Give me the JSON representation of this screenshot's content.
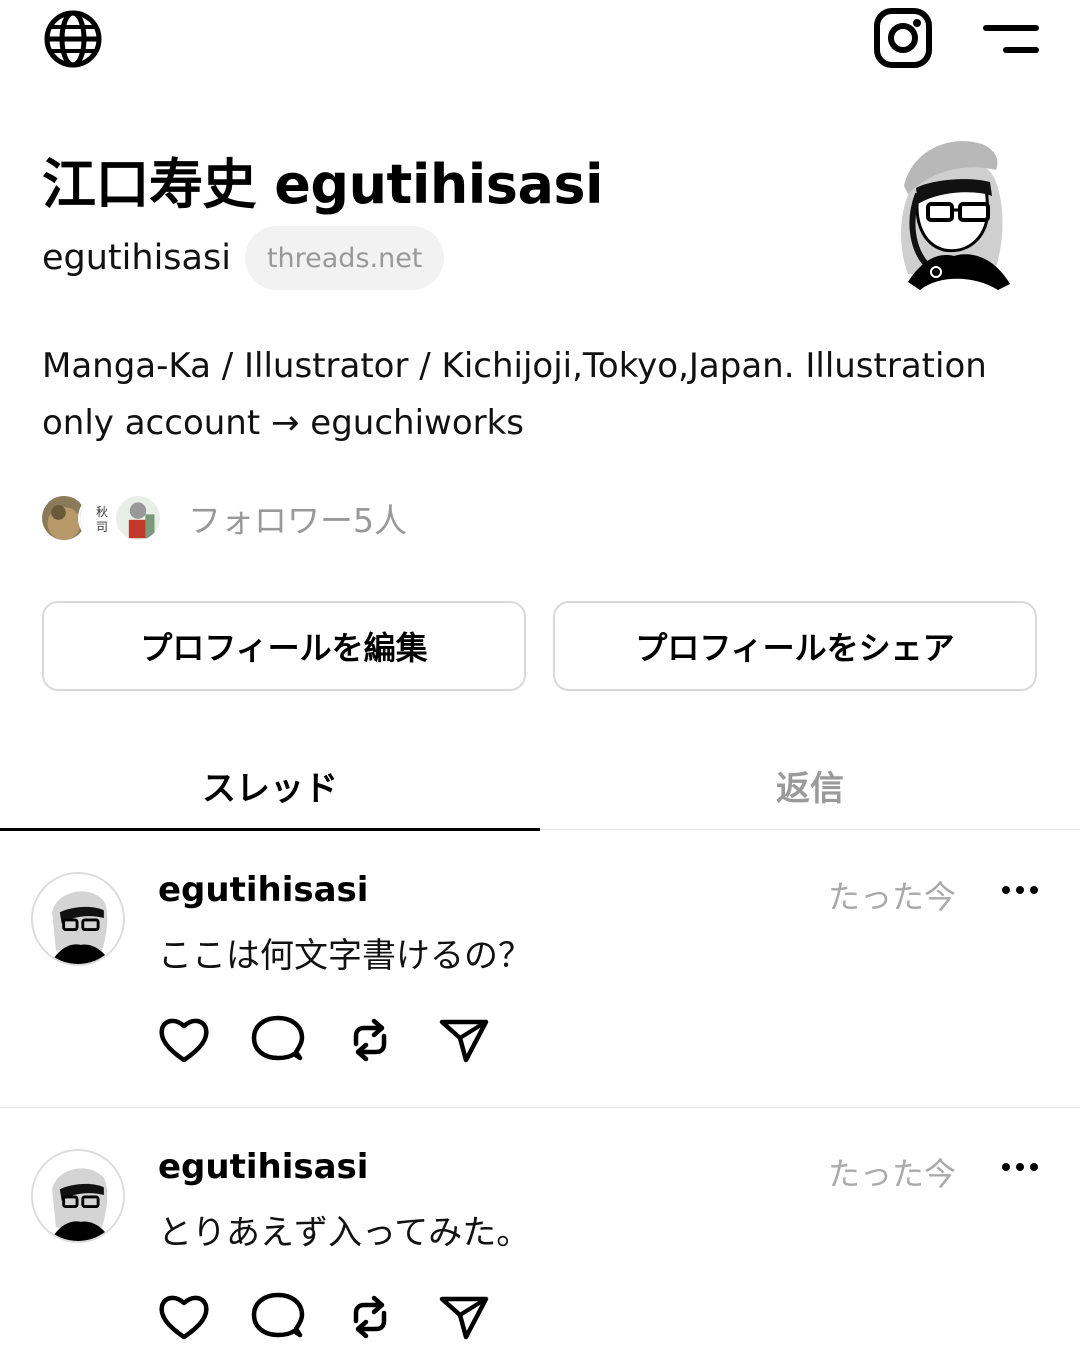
{
  "header": {
    "globe_icon": "globe-icon",
    "instagram_icon": "instagram-icon",
    "menu_icon": "menu-icon"
  },
  "profile": {
    "name": "江口寿史 egutihisasi",
    "handle": "egutihisasi",
    "domain_badge": "threads.net",
    "bio": "Manga-Ka / Illustrator / Kichijoji,Tokyo,Japan. Illustration only account → eguchiworks",
    "followers_text": "フォロワー5人"
  },
  "buttons": {
    "edit_profile": "プロフィールを編集",
    "share_profile": "プロフィールをシェア"
  },
  "tabs": {
    "threads": "スレッド",
    "replies": "返信"
  },
  "posts": [
    {
      "username": "egutihisasi",
      "time": "たった今",
      "text": "ここは何文字書けるの？"
    },
    {
      "username": "egutihisasi",
      "time": "たった今",
      "text": "とりあえず入ってみた。"
    }
  ]
}
